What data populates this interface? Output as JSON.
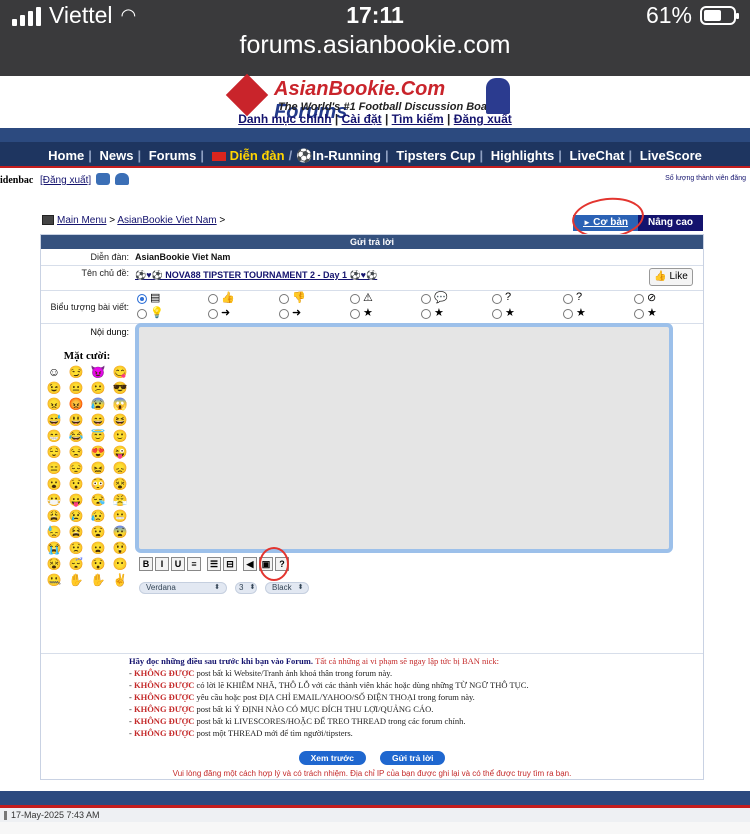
{
  "status": {
    "carrier": "Viettel",
    "time": "17:11",
    "battery_level": "61%",
    "battery_fraction": 0.61,
    "url": "forums.asianbookie.com"
  },
  "logo": {
    "name_a": "AsianBookie.Com",
    "name_b": "Forums",
    "tagline": "The World's #1 Football Discussion Board"
  },
  "toplinks": {
    "a": "Danh mục chính",
    "b": "Cài đặt",
    "c": "Tìm kiếm",
    "d": "Đăng xuất",
    "sep": "|"
  },
  "nav": [
    "Home",
    "News",
    "Forums",
    "Diễn đàn",
    "In-Running",
    "Tipsters Cup",
    "Highlights",
    "LiveChat",
    "LiveScore"
  ],
  "nav_sep": "|",
  "user": {
    "name": "idenbac",
    "logout": "[Đăng xuất]",
    "count_text": "Số lượng thành viên đăng"
  },
  "breadcrumb": {
    "main": "Main Menu",
    "sep": ">",
    "forum": "AsianBookie Viet Nam"
  },
  "modes": {
    "basic": "Cơ bản",
    "advanced": "Nâng cao"
  },
  "form": {
    "title": "Gửi trả lời",
    "forum_label": "Diễn đàn:",
    "forum_value": "AsianBookie Viet Nam",
    "topic_label": "Tên chủ đề:",
    "topic_value": "⚽♥⚽ NOVA88 TIPSTER TOURNAMENT 2 - Day 1 ⚽♥⚽",
    "like": "Like",
    "icon_label": "Biểu tượng bài viết:",
    "content_label": "Nội dung:",
    "smilies_title": "Mặt cười:"
  },
  "post_icons": [
    "▤",
    "👍",
    "👎",
    "⚠",
    "💬",
    "?",
    "?",
    "⊘",
    "💡",
    "➜",
    "➜",
    "★",
    "★",
    "★",
    "★",
    "★"
  ],
  "post_icons_selected": 0,
  "smilies": [
    "☺",
    "😏",
    "😈",
    "😋",
    "😉",
    "😐",
    "😕",
    "😎",
    "😠",
    "😡",
    "😰",
    "😱",
    "😅",
    "😃",
    "😄",
    "😆",
    "😁",
    "😂",
    "😇",
    "🙂",
    "😌",
    "😒",
    "😍",
    "😜",
    "😑",
    "😔",
    "😖",
    "😞",
    "😮",
    "😯",
    "😳",
    "😵",
    "😷",
    "😛",
    "😪",
    "😤",
    "😩",
    "😢",
    "😥",
    "😬",
    "😓",
    "😫",
    "😧",
    "😨",
    "😭",
    "😟",
    "😦",
    "😲",
    "😵",
    "😴",
    "😯",
    "😶",
    "🤐",
    "✋",
    "✋",
    "✌"
  ],
  "toolbar": [
    "B",
    "I",
    "U",
    "≡",
    "☰",
    "⊟",
    "◀",
    "▣",
    "?"
  ],
  "font_select": {
    "font": "Verdana",
    "size": "3",
    "color": "Black"
  },
  "rules": {
    "heading": "Hãy đọc những điều sau trước khi bạn vào Forum.",
    "heading_warn": "Tất cả những ai vi phạm sẽ ngay lập tức bị BAN nick:",
    "bad": "KHÔNG ĐƯỢC",
    "lines": [
      "post bất kì Website/Tranh ảnh khoả thân trong forum này.",
      "có lời lẽ KHIÊM NHÃ, THÔ LỖ với các thành viên khác hoặc dùng những TỪ NGỮ THÔ TỤC.",
      "yêu cầu hoặc post ĐỊA CHỈ EMAIL/YAHOO/SỐ ĐIỆN THOẠI trong forum này.",
      "post bất kì Ý ĐỊNH NÀO CÓ MỤC ĐÍCH THU LỢI/QUẢNG CÁO.",
      "post bất kì LIVESCORES/HOẶC ĐỂ TREO THREAD trong các forum chính.",
      "post một THREAD mới để tìm người/tipsters."
    ]
  },
  "buttons": {
    "preview": "Xem trước",
    "submit": "Gửi trả lời"
  },
  "note": "Vui lòng đăng một cách hợp lý và có trách nhiệm. Địa chỉ IP của bạn được ghi lại và có thể được truy tìm ra bạn.",
  "footer_date": "17-May-2025 7:43 AM"
}
